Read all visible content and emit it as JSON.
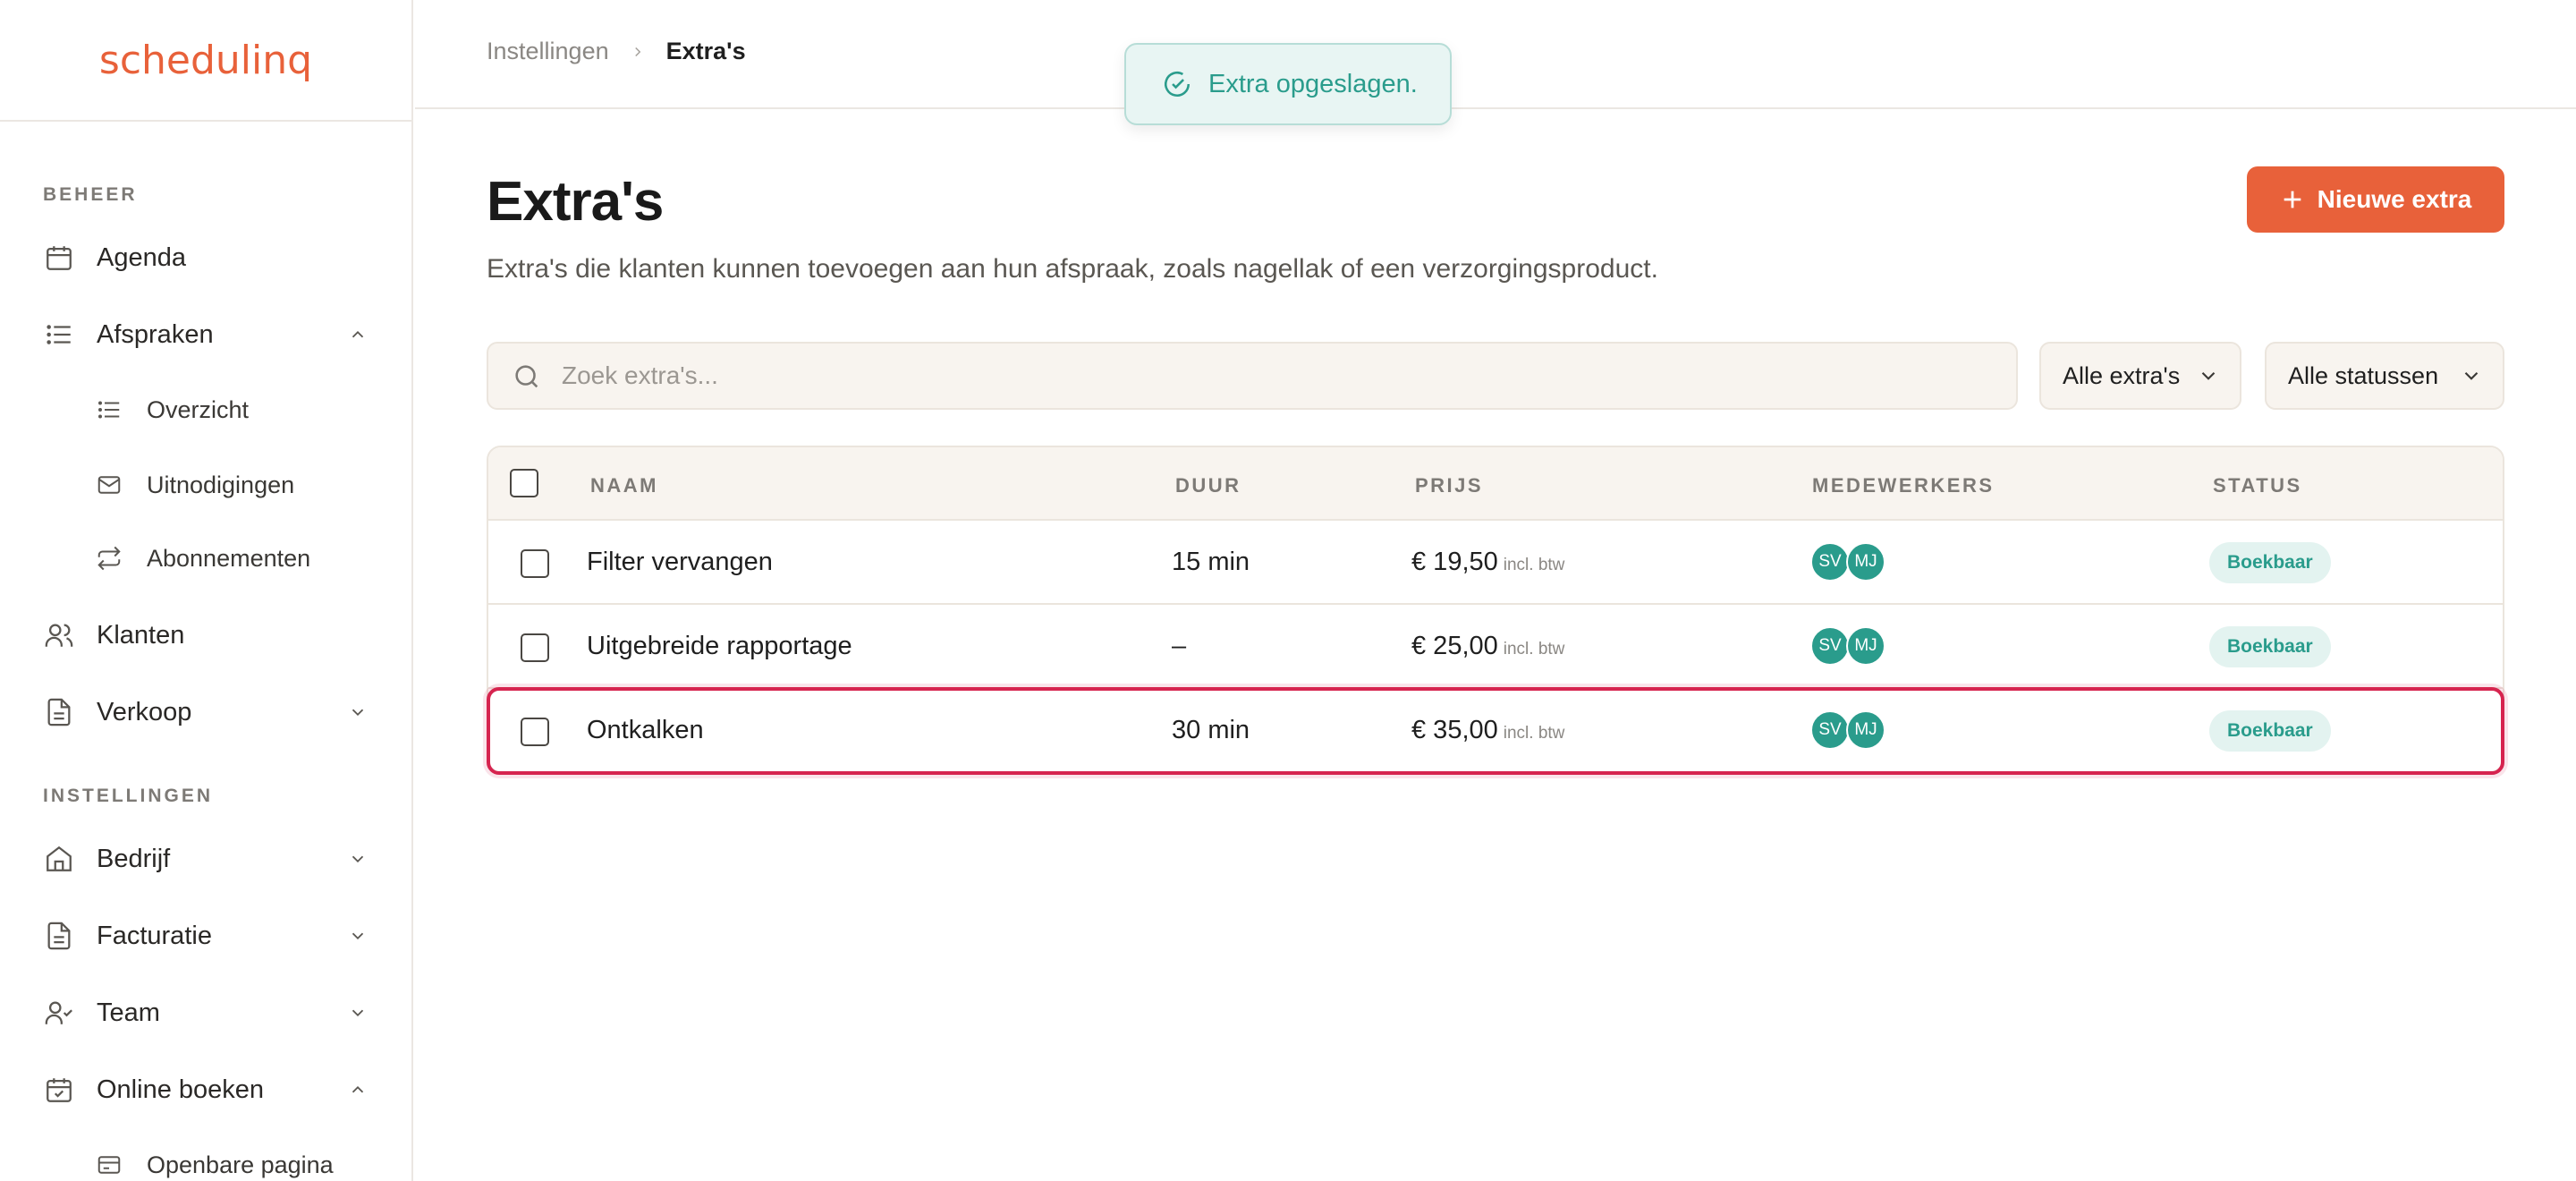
{
  "app": {
    "logo": "schedulinq",
    "accent": "#e8613a",
    "teal": "#2a9c8c"
  },
  "sidebar": {
    "sections": [
      {
        "label": "BEHEER"
      },
      {
        "label": "INSTELLINGEN"
      }
    ],
    "items": [
      {
        "label": "Agenda",
        "icon": "calendar-icon"
      },
      {
        "label": "Afspraken",
        "icon": "list-icon",
        "expanded": true
      },
      {
        "label": "Overzicht",
        "icon": "list-icon",
        "sub": true
      },
      {
        "label": "Uitnodigingen",
        "icon": "mail-icon",
        "sub": true
      },
      {
        "label": "Abonnementen",
        "icon": "repeat-icon",
        "sub": true
      },
      {
        "label": "Klanten",
        "icon": "users-icon"
      },
      {
        "label": "Verkoop",
        "icon": "document-icon",
        "expanded": false
      },
      {
        "label": "Bedrijf",
        "icon": "home-icon",
        "expanded": false
      },
      {
        "label": "Facturatie",
        "icon": "document-icon",
        "expanded": false
      },
      {
        "label": "Team",
        "icon": "user-check-icon",
        "expanded": false
      },
      {
        "label": "Online boeken",
        "icon": "calendar-check-icon",
        "expanded": true
      },
      {
        "label": "Openbare pagina",
        "icon": "card-icon",
        "sub": true
      }
    ]
  },
  "breadcrumb": {
    "parent": "Instellingen",
    "current": "Extra's"
  },
  "toast": {
    "message": "Extra opgeslagen."
  },
  "page": {
    "title": "Extra's",
    "description": "Extra's die klanten kunnen toevoegen aan hun afspraak, zoals nagellak of een verzorgingsproduct.",
    "new_button": "Nieuwe extra"
  },
  "filters": {
    "search_placeholder": "Zoek extra's...",
    "type_select": "Alle extra's",
    "status_select": "Alle statussen"
  },
  "table": {
    "columns": [
      "NAAM",
      "DUUR",
      "PRIJS",
      "MEDEWERKERS",
      "STATUS"
    ],
    "rows": [
      {
        "name": "Filter vervangen",
        "duration": "15 min",
        "price": "€ 19,50",
        "price_note": "incl. btw",
        "staff": [
          "SV",
          "MJ"
        ],
        "status": "Boekbaar"
      },
      {
        "name": "Uitgebreide rapportage",
        "duration": "–",
        "price": "€ 25,00",
        "price_note": "incl. btw",
        "staff": [
          "SV",
          "MJ"
        ],
        "status": "Boekbaar"
      },
      {
        "name": "Ontkalken",
        "duration": "30 min",
        "price": "€ 35,00",
        "price_note": "incl. btw",
        "staff": [
          "SV",
          "MJ"
        ],
        "status": "Boekbaar",
        "highlighted": true
      }
    ]
  }
}
